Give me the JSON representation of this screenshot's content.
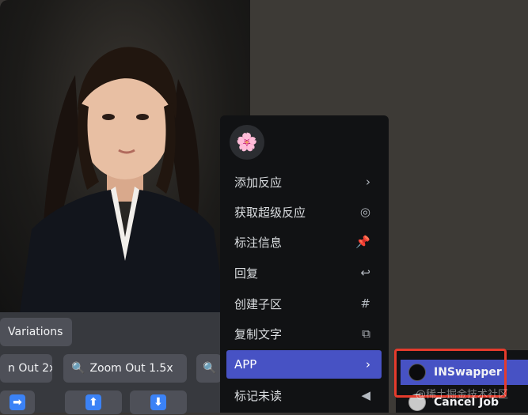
{
  "left_buttons": {
    "variations": "Variations",
    "zoom_out_2x": "n Out 2x",
    "zoom_out_1_5x": "Zoom Out 1.5x"
  },
  "arrow_buttons": [
    {
      "glyph": "➡",
      "icon": "arrow-right-icon"
    },
    {
      "glyph": "⬆",
      "icon": "arrow-up-icon"
    },
    {
      "glyph": "⬇",
      "icon": "arrow-down-icon"
    }
  ],
  "context_menu": {
    "reaction_emoji": "🌸",
    "items": [
      {
        "label": "添加反应",
        "icon_glyph": "›",
        "icon": "chevron-right-icon"
      },
      {
        "label": "获取超级反应",
        "icon_glyph": "◎",
        "icon": "super-reaction-icon"
      },
      {
        "label": "标注信息",
        "icon_glyph": "📌",
        "icon": "pin-icon"
      },
      {
        "label": "回复",
        "icon_glyph": "↩",
        "icon": "reply-icon"
      },
      {
        "label": "创建子区",
        "icon_glyph": "#",
        "icon": "thread-icon"
      },
      {
        "label": "复制文字",
        "icon_glyph": "⧉",
        "icon": "copy-icon"
      },
      {
        "label": "APP",
        "icon_glyph": "›",
        "icon": "chevron-right-icon",
        "active": true
      },
      {
        "label": "标记未读",
        "icon_glyph": "◀",
        "icon": "mark-unread-icon"
      }
    ]
  },
  "app_submenu": {
    "items": [
      {
        "label": "INSwapper",
        "active": true
      },
      {
        "label": "Cancel Job",
        "active": false
      }
    ]
  },
  "watermark": "@稀土掘金技术社区",
  "colors": {
    "accent": "#4752c4",
    "highlight": "#e53b2c",
    "menu_bg": "#111214",
    "button_bg": "#4e5058"
  }
}
